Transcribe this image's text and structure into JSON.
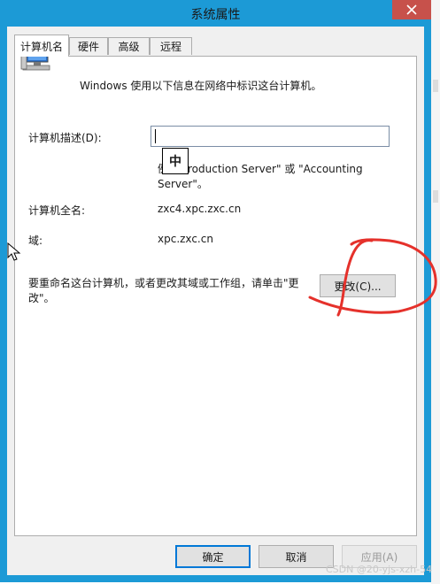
{
  "window": {
    "title": "系统属性"
  },
  "tabs": [
    {
      "label": "计算机名"
    },
    {
      "label": "硬件"
    },
    {
      "label": "高级"
    },
    {
      "label": "远程"
    }
  ],
  "panel": {
    "intro_text": "Windows 使用以下信息在网络中标识这台计算机。",
    "description_label": "计算机描述(D):",
    "description_value": "",
    "ime_indicator": "中",
    "example_text_line1": "例IS Production Server\" 或 \"Accounting",
    "example_text_line2": "Server\"。",
    "full_name_label": "计算机全名:",
    "full_name_value": "zxc4.xpc.zxc.cn",
    "domain_label": "域:",
    "domain_value": "xpc.zxc.cn",
    "rename_text_line1": "要重命名这台计算机，或者更改其域或工作组，请单击\"更",
    "rename_text_line2": "改\"。",
    "change_button": "更改(C)..."
  },
  "footer": {
    "ok_button": "确定",
    "cancel_button": "取消",
    "apply_button": "应用(A)"
  },
  "watermark": "CSDN @20-yjs-xzh-54",
  "colors": {
    "title_bar": "#1c9ad6",
    "close_button": "#c7514b",
    "annotation_red": "#e5312b",
    "default_button_border": "#0078d7"
  },
  "icons": {
    "close": "close-icon",
    "computer": "computer-icon",
    "cursor": "mouse-cursor-icon"
  }
}
